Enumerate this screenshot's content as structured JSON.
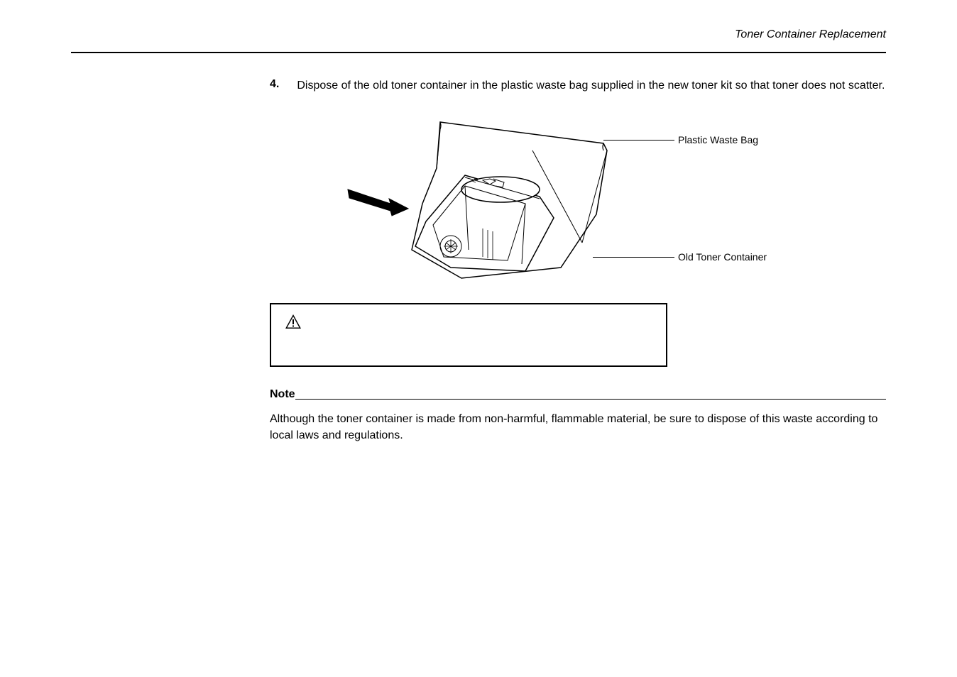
{
  "header": {
    "section_title": "Toner Container Replacement"
  },
  "step": {
    "number": "4.",
    "text": "Dispose of the old toner container in the plastic waste bag supplied in the new toner kit so that toner does not scatter."
  },
  "diagram": {
    "label_bag": "Plastic Waste Bag",
    "label_container": "Old Toner Container"
  },
  "note": {
    "heading": "Note",
    "text": "Although the toner container is made from non-harmful, flammable material, be sure to dispose of this waste according to local laws and regulations."
  }
}
